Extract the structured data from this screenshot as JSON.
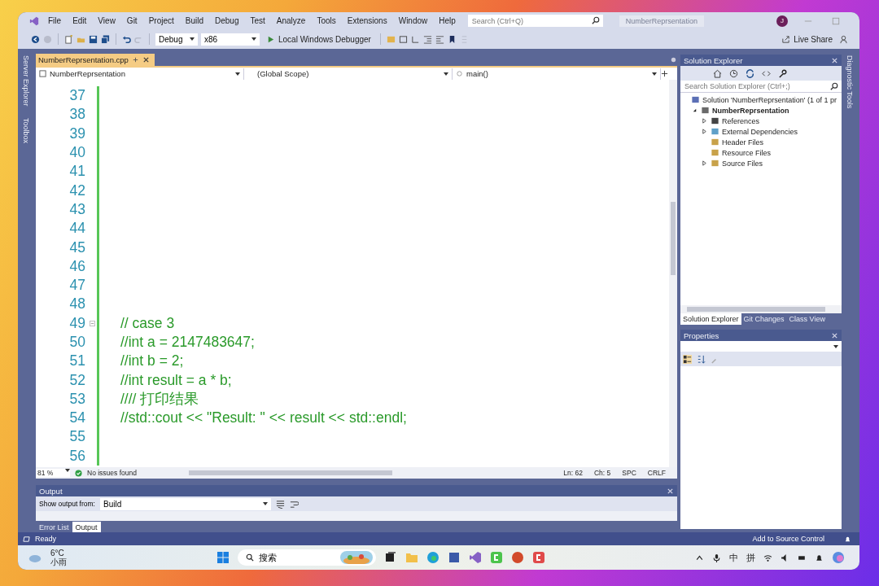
{
  "menu_bar": {
    "items": [
      "File",
      "Edit",
      "View",
      "Git",
      "Project",
      "Build",
      "Debug",
      "Test",
      "Analyze",
      "Tools",
      "Extensions",
      "Window",
      "Help"
    ],
    "search": {
      "placeholder": "Search (Ctrl+Q)"
    },
    "solution_name": "NumberReprsentation",
    "avatar": "J"
  },
  "toolbar": {
    "configuration": "Debug",
    "platform": "x86",
    "debugger": "Local Windows Debugger",
    "live_share": "Live Share"
  },
  "side_tabs_left": [
    "Server Explorer",
    "Toolbox"
  ],
  "editor": {
    "tabs": [
      {
        "label": "NumberReprsentation.cpp",
        "selected": true
      }
    ],
    "project_dropdown": "NumberReprsentation",
    "scope_dropdown": "(Global Scope)",
    "member_dropdown": "main()",
    "lines": [
      {
        "number": "37"
      },
      {
        "number": "38"
      },
      {
        "number": "39"
      },
      {
        "number": "40"
      },
      {
        "number": "41"
      },
      {
        "number": "42"
      },
      {
        "number": "43"
      },
      {
        "number": "44"
      },
      {
        "number": "45"
      },
      {
        "number": "46"
      },
      {
        "number": "47"
      },
      {
        "number": "48"
      },
      {
        "number": "49",
        "text": "// case 3",
        "fold": true
      },
      {
        "number": "50",
        "text": "//int a = 2147483647;"
      },
      {
        "number": "51",
        "text": "//int b = 2;"
      },
      {
        "number": "52",
        "text": "//int result = a * b;"
      },
      {
        "number": "53",
        "text": "//// 打印结果"
      },
      {
        "number": "54",
        "text": "//std::cout << \"Result: \" << result << std::endl;"
      },
      {
        "number": "55"
      },
      {
        "number": "56"
      }
    ],
    "zoom": "81 %",
    "issues": "No issues found",
    "ln": "Ln: 62",
    "ch": "Ch: 5",
    "spc": "SPC",
    "crlf": "CRLF"
  },
  "output": {
    "title": "Output",
    "show_from_label": "Show output from:",
    "source": "Build"
  },
  "bottom_tabs": [
    {
      "label": "Error List",
      "selected": false
    },
    {
      "label": "Output",
      "selected": true
    }
  ],
  "solution_explorer": {
    "title": "Solution Explorer",
    "search": {
      "placeholder": "Search Solution Explorer (Ctrl+;)"
    },
    "tree": [
      {
        "label": "Solution 'NumberReprsentation' (1 of 1 pr",
        "kind": "solution",
        "children": [
          {
            "label": "NumberReprsentation",
            "kind": "project",
            "expanded": true,
            "children": [
              {
                "label": "References",
                "kind": "references",
                "expanded": false
              },
              {
                "label": "External Dependencies",
                "kind": "dependencies",
                "expanded": false
              },
              {
                "label": "Header Files",
                "kind": "filter"
              },
              {
                "label": "Resource Files",
                "kind": "filter"
              },
              {
                "label": "Source Files",
                "kind": "filter",
                "expanded": false
              }
            ]
          }
        ]
      }
    ],
    "tabs": [
      {
        "label": "Solution Explorer",
        "selected": true
      },
      {
        "label": "Git Changes",
        "selected": false
      },
      {
        "label": "Class View",
        "selected": false
      }
    ]
  },
  "properties": {
    "title": "Properties"
  },
  "side_tabs_right": [
    "Diagnostic Tools"
  ],
  "status_bar": {
    "text": "Ready",
    "source_control": "Add to Source Control"
  },
  "taskbar": {
    "temperature": "6°C",
    "weather": "小雨",
    "search": "搜索",
    "ime": [
      "中",
      "拼"
    ]
  }
}
